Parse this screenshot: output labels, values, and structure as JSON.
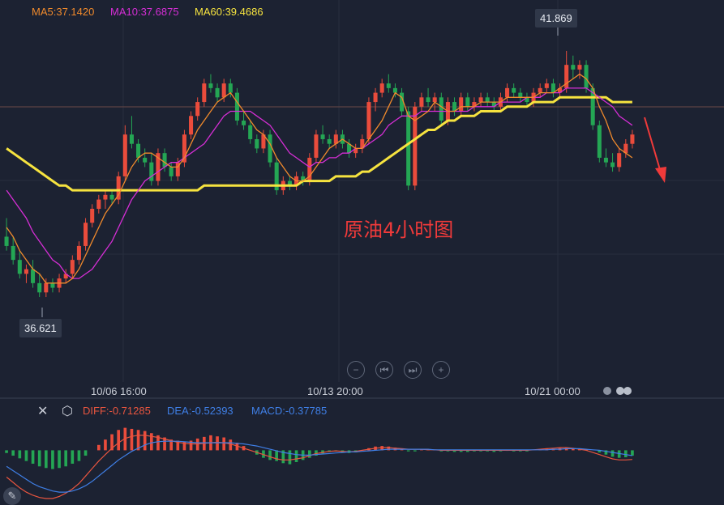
{
  "ma_labels": {
    "ma5": "MA5:37.1420",
    "ma10": "MA10:37.6875",
    "ma60": "MA60:39.4686"
  },
  "price_tags": {
    "high": "41.869",
    "low": "36.621"
  },
  "date_labels": [
    "10/06 16:00",
    "10/13 20:00",
    "10/21 00:00"
  ],
  "annotation": "原油4小时图",
  "macd_labels": {
    "diff": "DIFF:-0.71285",
    "dea": "DEA:-0.52393",
    "macd": "MACD:-0.37785"
  },
  "icons": [
    "close-icon",
    "settings-icon",
    "first-page-icon",
    "prev-page-icon",
    "next-page-icon",
    "zoom-in-icon",
    "zoom-out-icon",
    "drawing-tool-icon"
  ],
  "colors": {
    "background": "#1c2232",
    "up_candle": "#ea4c3c",
    "down_candle": "#24a654",
    "ma5": "#f08a2c",
    "ma10": "#d52ed5",
    "ma60": "#f6e33f",
    "diff_line": "#e8553f",
    "dea_line": "#3f7fe6",
    "arrow": "#f03a3a"
  },
  "chart_data": {
    "type": "candlestick",
    "title": "",
    "price_range": [
      36.2,
      42.3
    ],
    "x_tick_labels": [
      "10/06 16:00",
      "10/13 20:00",
      "10/21 00:00"
    ],
    "candles": [
      {
        "o": 37.9,
        "h": 38.3,
        "l": 37.6,
        "c": 37.7
      },
      {
        "o": 37.7,
        "h": 37.9,
        "l": 37.3,
        "c": 37.4
      },
      {
        "o": 37.4,
        "h": 37.6,
        "l": 37.0,
        "c": 37.1
      },
      {
        "o": 37.1,
        "h": 37.3,
        "l": 36.9,
        "c": 37.2
      },
      {
        "o": 37.2,
        "h": 37.4,
        "l": 36.8,
        "c": 36.9
      },
      {
        "o": 36.9,
        "h": 37.1,
        "l": 36.6,
        "c": 36.7
      },
      {
        "o": 36.7,
        "h": 37.0,
        "l": 36.6,
        "c": 36.9
      },
      {
        "o": 36.9,
        "h": 37.0,
        "l": 36.7,
        "c": 36.8
      },
      {
        "o": 36.8,
        "h": 37.1,
        "l": 36.7,
        "c": 37.0
      },
      {
        "o": 37.0,
        "h": 37.2,
        "l": 36.9,
        "c": 37.1
      },
      {
        "o": 37.1,
        "h": 37.5,
        "l": 37.0,
        "c": 37.4
      },
      {
        "o": 37.4,
        "h": 37.8,
        "l": 37.3,
        "c": 37.7
      },
      {
        "o": 37.7,
        "h": 38.3,
        "l": 37.6,
        "c": 38.2
      },
      {
        "o": 38.2,
        "h": 38.6,
        "l": 38.1,
        "c": 38.5
      },
      {
        "o": 38.5,
        "h": 38.8,
        "l": 38.4,
        "c": 38.7
      },
      {
        "o": 38.7,
        "h": 38.9,
        "l": 38.5,
        "c": 38.8
      },
      {
        "o": 38.8,
        "h": 38.9,
        "l": 38.6,
        "c": 38.7
      },
      {
        "o": 38.7,
        "h": 39.3,
        "l": 38.6,
        "c": 39.2
      },
      {
        "o": 39.2,
        "h": 40.3,
        "l": 39.1,
        "c": 40.1
      },
      {
        "o": 40.1,
        "h": 40.5,
        "l": 39.8,
        "c": 39.9
      },
      {
        "o": 39.9,
        "h": 40.0,
        "l": 39.5,
        "c": 39.6
      },
      {
        "o": 39.6,
        "h": 39.8,
        "l": 39.4,
        "c": 39.5
      },
      {
        "o": 39.5,
        "h": 39.7,
        "l": 39.0,
        "c": 39.1
      },
      {
        "o": 39.1,
        "h": 39.8,
        "l": 39.0,
        "c": 39.7
      },
      {
        "o": 39.7,
        "h": 39.8,
        "l": 39.3,
        "c": 39.4
      },
      {
        "o": 39.4,
        "h": 39.5,
        "l": 39.1,
        "c": 39.2
      },
      {
        "o": 39.2,
        "h": 39.6,
        "l": 39.1,
        "c": 39.5
      },
      {
        "o": 39.5,
        "h": 40.2,
        "l": 39.4,
        "c": 40.1
      },
      {
        "o": 40.1,
        "h": 40.6,
        "l": 40.0,
        "c": 40.5
      },
      {
        "o": 40.5,
        "h": 40.9,
        "l": 40.4,
        "c": 40.8
      },
      {
        "o": 40.8,
        "h": 41.3,
        "l": 40.7,
        "c": 41.2
      },
      {
        "o": 41.2,
        "h": 41.4,
        "l": 41.0,
        "c": 41.1
      },
      {
        "o": 41.1,
        "h": 41.2,
        "l": 40.8,
        "c": 40.9
      },
      {
        "o": 40.9,
        "h": 41.3,
        "l": 40.8,
        "c": 41.2
      },
      {
        "o": 41.2,
        "h": 41.3,
        "l": 40.9,
        "c": 41.0
      },
      {
        "o": 41.0,
        "h": 41.1,
        "l": 40.3,
        "c": 40.4
      },
      {
        "o": 40.4,
        "h": 40.6,
        "l": 40.2,
        "c": 40.3
      },
      {
        "o": 40.3,
        "h": 40.4,
        "l": 39.9,
        "c": 40.0
      },
      {
        "o": 40.0,
        "h": 40.1,
        "l": 39.7,
        "c": 39.8
      },
      {
        "o": 39.8,
        "h": 40.2,
        "l": 39.7,
        "c": 40.1
      },
      {
        "o": 40.1,
        "h": 40.2,
        "l": 39.4,
        "c": 39.5
      },
      {
        "o": 39.5,
        "h": 39.6,
        "l": 38.8,
        "c": 38.9
      },
      {
        "o": 38.9,
        "h": 39.2,
        "l": 38.8,
        "c": 39.1
      },
      {
        "o": 39.1,
        "h": 39.2,
        "l": 38.9,
        "c": 39.0
      },
      {
        "o": 39.0,
        "h": 39.3,
        "l": 38.9,
        "c": 39.2
      },
      {
        "o": 39.2,
        "h": 39.3,
        "l": 39.0,
        "c": 39.1
      },
      {
        "o": 39.1,
        "h": 39.7,
        "l": 39.0,
        "c": 39.6
      },
      {
        "o": 39.6,
        "h": 40.2,
        "l": 39.5,
        "c": 40.1
      },
      {
        "o": 40.1,
        "h": 40.3,
        "l": 39.9,
        "c": 40.0
      },
      {
        "o": 40.0,
        "h": 40.1,
        "l": 39.8,
        "c": 39.9
      },
      {
        "o": 39.9,
        "h": 40.2,
        "l": 39.8,
        "c": 40.1
      },
      {
        "o": 40.1,
        "h": 40.2,
        "l": 39.8,
        "c": 39.9
      },
      {
        "o": 39.9,
        "h": 40.0,
        "l": 39.6,
        "c": 39.7
      },
      {
        "o": 39.7,
        "h": 39.9,
        "l": 39.6,
        "c": 39.8
      },
      {
        "o": 39.8,
        "h": 40.1,
        "l": 39.7,
        "c": 40.0
      },
      {
        "o": 40.0,
        "h": 40.9,
        "l": 39.9,
        "c": 40.8
      },
      {
        "o": 40.8,
        "h": 41.1,
        "l": 40.6,
        "c": 41.0
      },
      {
        "o": 41.0,
        "h": 41.3,
        "l": 40.9,
        "c": 41.2
      },
      {
        "o": 41.2,
        "h": 41.4,
        "l": 41.0,
        "c": 41.1
      },
      {
        "o": 41.1,
        "h": 41.2,
        "l": 40.9,
        "c": 41.0
      },
      {
        "o": 41.0,
        "h": 41.1,
        "l": 40.5,
        "c": 40.6
      },
      {
        "o": 40.6,
        "h": 40.7,
        "l": 38.9,
        "c": 39.0
      },
      {
        "o": 39.0,
        "h": 40.8,
        "l": 38.9,
        "c": 40.7
      },
      {
        "o": 40.7,
        "h": 41.0,
        "l": 40.6,
        "c": 40.9
      },
      {
        "o": 40.9,
        "h": 41.1,
        "l": 40.7,
        "c": 40.8
      },
      {
        "o": 40.8,
        "h": 41.0,
        "l": 40.6,
        "c": 40.9
      },
      {
        "o": 40.9,
        "h": 41.0,
        "l": 40.3,
        "c": 40.4
      },
      {
        "o": 40.4,
        "h": 40.9,
        "l": 40.3,
        "c": 40.8
      },
      {
        "o": 40.8,
        "h": 40.9,
        "l": 40.5,
        "c": 40.6
      },
      {
        "o": 40.6,
        "h": 41.0,
        "l": 40.5,
        "c": 40.9
      },
      {
        "o": 40.9,
        "h": 41.0,
        "l": 40.6,
        "c": 40.7
      },
      {
        "o": 40.7,
        "h": 40.9,
        "l": 40.6,
        "c": 40.8
      },
      {
        "o": 40.8,
        "h": 41.0,
        "l": 40.7,
        "c": 40.9
      },
      {
        "o": 40.9,
        "h": 41.0,
        "l": 40.7,
        "c": 40.8
      },
      {
        "o": 40.8,
        "h": 40.9,
        "l": 40.6,
        "c": 40.7
      },
      {
        "o": 40.7,
        "h": 41.0,
        "l": 40.6,
        "c": 40.9
      },
      {
        "o": 40.9,
        "h": 41.2,
        "l": 40.8,
        "c": 41.1
      },
      {
        "o": 41.1,
        "h": 41.2,
        "l": 40.9,
        "c": 41.0
      },
      {
        "o": 41.0,
        "h": 41.1,
        "l": 40.8,
        "c": 40.9
      },
      {
        "o": 40.9,
        "h": 41.0,
        "l": 40.7,
        "c": 40.8
      },
      {
        "o": 40.8,
        "h": 41.1,
        "l": 40.7,
        "c": 41.0
      },
      {
        "o": 41.0,
        "h": 41.2,
        "l": 40.9,
        "c": 41.1
      },
      {
        "o": 41.1,
        "h": 41.3,
        "l": 41.0,
        "c": 41.2
      },
      {
        "o": 41.2,
        "h": 41.3,
        "l": 40.9,
        "c": 41.0
      },
      {
        "o": 41.0,
        "h": 41.2,
        "l": 40.9,
        "c": 41.1
      },
      {
        "o": 41.1,
        "h": 41.9,
        "l": 41.0,
        "c": 41.6
      },
      {
        "o": 41.6,
        "h": 41.8,
        "l": 41.3,
        "c": 41.5
      },
      {
        "o": 41.5,
        "h": 41.7,
        "l": 41.3,
        "c": 41.6
      },
      {
        "o": 41.6,
        "h": 41.7,
        "l": 41.0,
        "c": 41.1
      },
      {
        "o": 41.1,
        "h": 41.2,
        "l": 40.2,
        "c": 40.3
      },
      {
        "o": 40.3,
        "h": 40.4,
        "l": 39.5,
        "c": 39.6
      },
      {
        "o": 39.6,
        "h": 39.8,
        "l": 39.4,
        "c": 39.5
      },
      {
        "o": 39.5,
        "h": 39.7,
        "l": 39.3,
        "c": 39.4
      },
      {
        "o": 39.4,
        "h": 39.8,
        "l": 39.3,
        "c": 39.7
      },
      {
        "o": 39.7,
        "h": 40.0,
        "l": 39.6,
        "c": 39.9
      },
      {
        "o": 39.9,
        "h": 40.2,
        "l": 39.8,
        "c": 40.1
      }
    ],
    "ma5": [
      38.1,
      37.9,
      37.6,
      37.4,
      37.2,
      37.1,
      36.9,
      36.9,
      36.9,
      36.9,
      37.0,
      37.2,
      37.5,
      37.8,
      38.1,
      38.4,
      38.6,
      38.8,
      39.1,
      39.4,
      39.6,
      39.7,
      39.7,
      39.6,
      39.5,
      39.4,
      39.4,
      39.6,
      39.9,
      40.2,
      40.4,
      40.6,
      40.8,
      40.9,
      41.0,
      40.8,
      40.6,
      40.4,
      40.2,
      40.1,
      39.9,
      39.6,
      39.4,
      39.2,
      39.1,
      39.1,
      39.2,
      39.4,
      39.6,
      39.8,
      39.9,
      40.0,
      39.9,
      39.8,
      39.8,
      40.0,
      40.2,
      40.4,
      40.7,
      41.0,
      40.9,
      40.5,
      40.4,
      40.5,
      40.6,
      40.8,
      40.7,
      40.6,
      40.6,
      40.7,
      40.7,
      40.7,
      40.8,
      40.8,
      40.8,
      40.8,
      40.9,
      40.9,
      40.9,
      40.9,
      40.9,
      41.0,
      41.0,
      41.0,
      41.1,
      41.2,
      41.3,
      41.4,
      41.3,
      41.1,
      40.7,
      40.4,
      40.0,
      39.8,
      39.7,
      39.6
    ],
    "ma10": [
      38.9,
      38.7,
      38.5,
      38.3,
      38.0,
      37.8,
      37.6,
      37.4,
      37.3,
      37.1,
      37.0,
      37.0,
      37.1,
      37.2,
      37.4,
      37.6,
      37.8,
      38.1,
      38.4,
      38.7,
      38.9,
      39.1,
      39.2,
      39.3,
      39.4,
      39.5,
      39.5,
      39.6,
      39.7,
      39.8,
      39.9,
      40.1,
      40.3,
      40.5,
      40.6,
      40.6,
      40.6,
      40.6,
      40.5,
      40.4,
      40.3,
      40.1,
      39.9,
      39.7,
      39.6,
      39.5,
      39.4,
      39.5,
      39.5,
      39.6,
      39.6,
      39.7,
      39.7,
      39.8,
      39.8,
      39.9,
      40.0,
      40.1,
      40.3,
      40.4,
      40.5,
      40.5,
      40.5,
      40.6,
      40.6,
      40.6,
      40.6,
      40.6,
      40.6,
      40.6,
      40.6,
      40.7,
      40.7,
      40.7,
      40.7,
      40.8,
      40.8,
      40.8,
      40.8,
      40.9,
      40.9,
      40.9,
      41.0,
      41.0,
      41.0,
      41.1,
      41.1,
      41.1,
      41.1,
      41.0,
      40.9,
      40.8,
      40.7,
      40.5,
      40.4,
      40.3
    ],
    "ma60": [
      39.8,
      39.7,
      39.6,
      39.5,
      39.4,
      39.3,
      39.2,
      39.1,
      39.0,
      39.0,
      38.9,
      38.9,
      38.9,
      38.9,
      38.9,
      38.9,
      38.9,
      38.9,
      38.9,
      38.9,
      38.9,
      38.9,
      38.9,
      38.9,
      38.9,
      38.9,
      38.9,
      38.9,
      38.9,
      38.9,
      39.0,
      39.0,
      39.0,
      39.0,
      39.0,
      39.0,
      39.0,
      39.0,
      39.0,
      39.0,
      39.0,
      39.0,
      39.0,
      39.0,
      39.0,
      39.1,
      39.1,
      39.1,
      39.1,
      39.1,
      39.2,
      39.2,
      39.2,
      39.2,
      39.3,
      39.3,
      39.4,
      39.5,
      39.6,
      39.7,
      39.8,
      39.9,
      40.0,
      40.1,
      40.2,
      40.2,
      40.3,
      40.4,
      40.4,
      40.5,
      40.5,
      40.5,
      40.6,
      40.6,
      40.6,
      40.6,
      40.7,
      40.7,
      40.7,
      40.7,
      40.8,
      40.8,
      40.8,
      40.8,
      40.9,
      40.9,
      40.9,
      40.9,
      40.9,
      40.9,
      40.9,
      40.9,
      40.8,
      40.8,
      40.8,
      40.8
    ],
    "macd_range": [
      -0.9,
      0.55
    ],
    "macd_hist": [
      -0.05,
      -0.1,
      -0.15,
      -0.2,
      -0.25,
      -0.3,
      -0.33,
      -0.35,
      -0.33,
      -0.3,
      -0.25,
      -0.2,
      -0.1,
      0.0,
      0.1,
      0.2,
      0.3,
      0.38,
      0.42,
      0.4,
      0.38,
      0.36,
      0.32,
      0.28,
      0.24,
      0.2,
      0.18,
      0.16,
      0.18,
      0.22,
      0.25,
      0.28,
      0.26,
      0.24,
      0.2,
      0.14,
      0.08,
      0.0,
      -0.08,
      -0.14,
      -0.18,
      -0.2,
      -0.24,
      -0.26,
      -0.22,
      -0.18,
      -0.14,
      -0.1,
      -0.06,
      -0.03,
      -0.02,
      -0.04,
      -0.05,
      -0.04,
      0.0,
      0.04,
      0.07,
      0.08,
      0.07,
      0.05,
      0.02,
      -0.02,
      -0.02,
      0.02,
      0.02,
      0.01,
      -0.02,
      -0.02,
      -0.03,
      -0.03,
      -0.03,
      -0.02,
      -0.02,
      -0.02,
      -0.03,
      -0.02,
      -0.01,
      -0.02,
      -0.02,
      -0.02,
      0.0,
      0.02,
      0.03,
      0.03,
      0.04,
      0.05,
      0.04,
      0.03,
      0.02,
      0.0,
      -0.04,
      -0.08,
      -0.12,
      -0.14,
      -0.13,
      -0.1
    ],
    "diff": [
      -0.5,
      -0.6,
      -0.7,
      -0.78,
      -0.84,
      -0.88,
      -0.9,
      -0.9,
      -0.86,
      -0.8,
      -0.72,
      -0.62,
      -0.48,
      -0.34,
      -0.2,
      -0.08,
      0.04,
      0.14,
      0.22,
      0.26,
      0.28,
      0.28,
      0.26,
      0.24,
      0.21,
      0.18,
      0.15,
      0.13,
      0.12,
      0.12,
      0.13,
      0.14,
      0.15,
      0.14,
      0.12,
      0.08,
      0.04,
      0.0,
      -0.04,
      -0.08,
      -0.12,
      -0.16,
      -0.18,
      -0.18,
      -0.16,
      -0.14,
      -0.1,
      -0.06,
      -0.04,
      -0.02,
      -0.01,
      -0.02,
      -0.03,
      -0.02,
      0.0,
      0.02,
      0.04,
      0.05,
      0.05,
      0.04,
      0.03,
      0.02,
      0.02,
      0.02,
      0.01,
      0.01,
      0.0,
      0.0,
      0.0,
      0.0,
      0.0,
      0.0,
      0.0,
      0.0,
      0.0,
      0.0,
      0.0,
      0.0,
      0.0,
      0.0,
      0.01,
      0.02,
      0.03,
      0.04,
      0.05,
      0.05,
      0.04,
      0.02,
      0.0,
      -0.04,
      -0.08,
      -0.12,
      -0.16,
      -0.18,
      -0.18,
      -0.17
    ],
    "dea": [
      -0.3,
      -0.38,
      -0.46,
      -0.54,
      -0.62,
      -0.68,
      -0.72,
      -0.76,
      -0.78,
      -0.78,
      -0.76,
      -0.72,
      -0.66,
      -0.58,
      -0.48,
      -0.38,
      -0.28,
      -0.18,
      -0.1,
      -0.02,
      0.04,
      0.1,
      0.14,
      0.16,
      0.17,
      0.17,
      0.17,
      0.16,
      0.15,
      0.14,
      0.14,
      0.14,
      0.14,
      0.14,
      0.14,
      0.13,
      0.12,
      0.1,
      0.08,
      0.05,
      0.02,
      -0.01,
      -0.04,
      -0.06,
      -0.08,
      -0.09,
      -0.09,
      -0.08,
      -0.07,
      -0.06,
      -0.05,
      -0.04,
      -0.03,
      -0.03,
      -0.02,
      -0.01,
      0.0,
      0.01,
      0.02,
      0.02,
      0.02,
      0.02,
      0.02,
      0.02,
      0.02,
      0.01,
      0.01,
      0.01,
      0.01,
      0.01,
      0.01,
      0.01,
      0.01,
      0.01,
      0.01,
      0.01,
      0.01,
      0.01,
      0.01,
      0.01,
      0.01,
      0.01,
      0.01,
      0.02,
      0.02,
      0.03,
      0.03,
      0.03,
      0.02,
      0.01,
      0.0,
      -0.02,
      -0.04,
      -0.06,
      -0.08,
      -0.1
    ]
  }
}
